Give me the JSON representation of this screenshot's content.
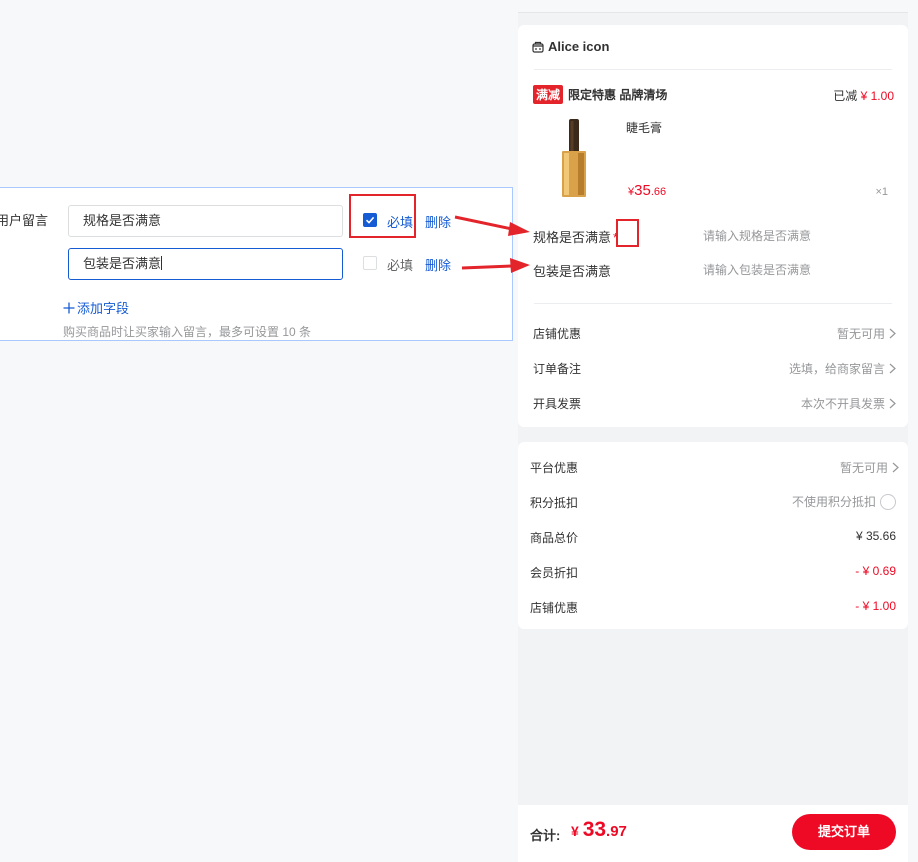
{
  "form": {
    "label": "用户留言",
    "fields": [
      {
        "value": "规格是否满意",
        "required": true
      },
      {
        "value": "包装是否满意",
        "required": false
      }
    ],
    "required_label": "必填",
    "delete_label": "删除",
    "add_field": "添加字段",
    "hint": "购买商品时让买家输入留言，最多可设置 10 条"
  },
  "preview": {
    "shop_name": "Alice icon",
    "promo": {
      "tag": "满减",
      "title": "限定特惠 品牌清场",
      "discount_prefix": "已减",
      "discount_value": "¥ 1.00"
    },
    "product": {
      "name": "睫毛膏",
      "price_symbol": "¥",
      "price_int": "35",
      "price_dec": ".66",
      "qty": "×1"
    },
    "messages": [
      {
        "label": "规格是否满意",
        "required_mark": "*",
        "placeholder": "请输入规格是否满意"
      },
      {
        "label": "包装是否满意",
        "placeholder": "请输入包装是否满意"
      }
    ],
    "shop_cells": [
      {
        "label": "店铺优惠",
        "value": "暂无可用"
      },
      {
        "label": "订单备注",
        "value": "选填，给商家留言"
      },
      {
        "label": "开具发票",
        "value": "本次不开具发票"
      }
    ],
    "platform_cells": [
      {
        "label": "平台优惠",
        "value": "暂无可用"
      },
      {
        "label": "积分抵扣",
        "value": "不使用积分抵扣"
      },
      {
        "label": "商品总价",
        "value": "¥ 35.66"
      },
      {
        "label": "会员折扣",
        "value": "- ¥ 0.69"
      },
      {
        "label": "店铺优惠",
        "value": "- ¥ 1.00"
      }
    ],
    "total": {
      "label": "合计:",
      "symbol": "¥",
      "int": "33",
      "dec": ".97"
    },
    "submit_label": "提交订单"
  },
  "colors": {
    "brand_blue": "#155bd4",
    "price_red": "#ee0a24",
    "annotation_red": "#e3242b"
  }
}
